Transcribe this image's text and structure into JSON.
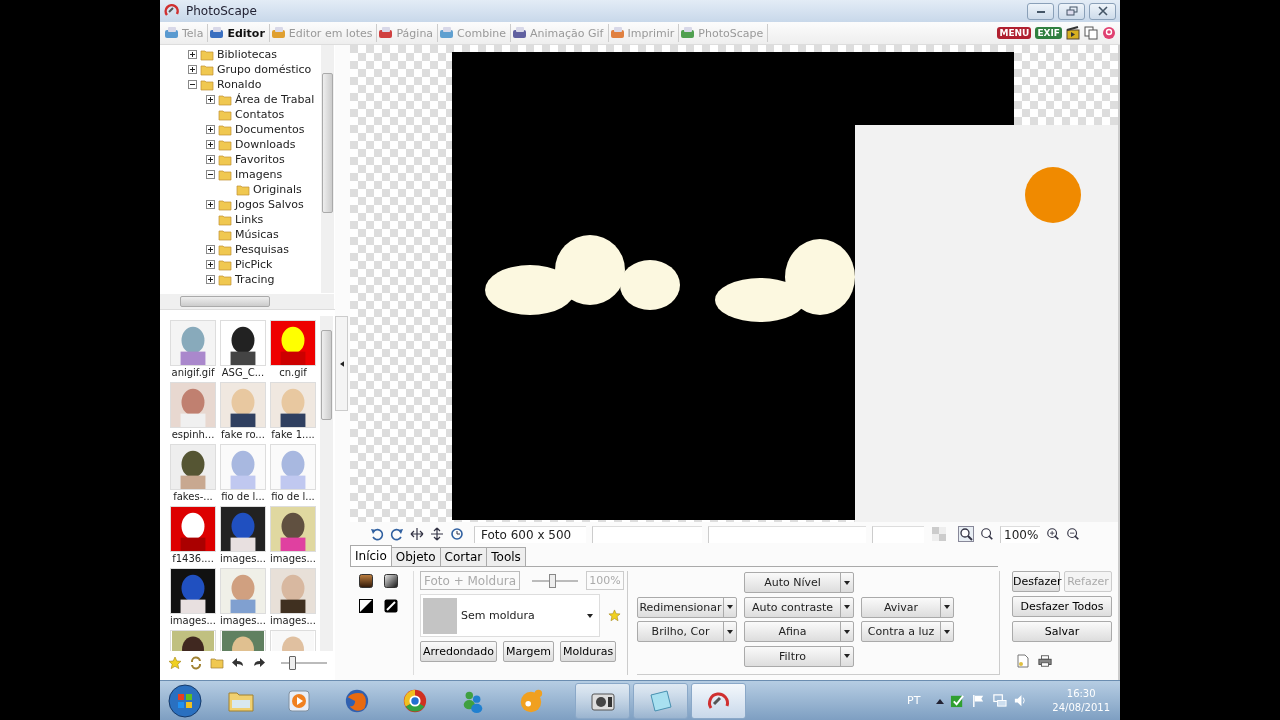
{
  "window": {
    "title": "PhotoScape"
  },
  "tabs": [
    {
      "label": "Tela",
      "selected": false
    },
    {
      "label": "Editor",
      "selected": true
    },
    {
      "label": "Editor em lotes",
      "selected": false
    },
    {
      "label": "Página",
      "selected": false
    },
    {
      "label": "Combine",
      "selected": false
    },
    {
      "label": "Animação Gif",
      "selected": false
    },
    {
      "label": "Imprimir",
      "selected": false
    },
    {
      "label": "PhotoScape",
      "selected": false
    }
  ],
  "toolbar": {
    "menu_label": "MENU",
    "exif_label": "EXIF"
  },
  "folder_tree": [
    {
      "label": "Bibliotecas",
      "expanded": false
    },
    {
      "label": "Grupo doméstico",
      "expanded": false
    },
    {
      "label": "Ronaldo",
      "expanded": true,
      "children": [
        {
          "label": "Área de Trabal",
          "expanded": false
        },
        {
          "label": "Contatos"
        },
        {
          "label": "Documentos",
          "expanded": false
        },
        {
          "label": "Downloads",
          "expanded": false
        },
        {
          "label": "Favoritos",
          "expanded": false
        },
        {
          "label": "Imagens",
          "expanded": true,
          "children": [
            {
              "label": "Originals"
            }
          ]
        },
        {
          "label": "Jogos Salvos",
          "expanded": false
        },
        {
          "label": "Links"
        },
        {
          "label": "Músicas"
        },
        {
          "label": "Pesquisas",
          "expanded": false
        },
        {
          "label": "PicPick",
          "expanded": false
        },
        {
          "label": "Tracing",
          "expanded": false
        }
      ]
    }
  ],
  "thumbnails": [
    {
      "kind": "captioned",
      "caption": "anigif.gif"
    },
    {
      "kind": "captioned",
      "caption": "ASG_C..."
    },
    {
      "kind": "captioned",
      "caption": "cn.gif"
    },
    {
      "kind": "captioned",
      "caption": "espinh..."
    },
    {
      "kind": "captioned",
      "caption": "fake ro..."
    },
    {
      "kind": "captioned",
      "caption": "fake 1...."
    },
    {
      "kind": "captioned",
      "caption": "fakes-..."
    },
    {
      "kind": "captioned",
      "caption": "fio de l..."
    },
    {
      "kind": "captioned",
      "caption": "fio de l..."
    },
    {
      "kind": "captioned",
      "caption": "f1436...."
    },
    {
      "kind": "captioned",
      "caption": "images..."
    },
    {
      "kind": "captioned",
      "caption": "images..."
    },
    {
      "kind": "captioned",
      "caption": "images..."
    },
    {
      "kind": "captioned",
      "caption": "images..."
    },
    {
      "kind": "captioned",
      "caption": "images..."
    },
    {
      "kind": "picture"
    },
    {
      "kind": "picture"
    },
    {
      "kind": "picture"
    }
  ],
  "thumbnail_size": {
    "level": 0.2
  },
  "status_bar": {
    "photo_size": "Foto 600 x 500",
    "zoom": "100%"
  },
  "edit_tabs": [
    {
      "label": "Início",
      "selected": true
    },
    {
      "label": "Objeto",
      "selected": false
    },
    {
      "label": "Cortar",
      "selected": false
    },
    {
      "label": "Tools",
      "selected": false
    }
  ],
  "frame": {
    "button": "Foto + Moldura",
    "button_disabled": true,
    "level": 0.4,
    "reading": "100%",
    "reading_disabled": true,
    "frame_name": "Sem moldura",
    "buttons": [
      "Arredondado",
      "Margem",
      "Molduras"
    ]
  },
  "filter_columns": [
    [
      "Redimensionar",
      "Brilho, Cor"
    ],
    [
      "Auto Nível",
      "Auto contraste",
      "Afina",
      "Filtro"
    ],
    [
      "Avivar",
      "Contra a luz"
    ]
  ],
  "history": [
    {
      "label": "Desfazer",
      "disabled": false
    },
    {
      "label": "Refazer",
      "disabled": true
    },
    {
      "label": "Desfazer Todos",
      "disabled": false
    },
    {
      "label": "Salvar",
      "disabled": false
    }
  ],
  "taskbar": {
    "language": "PT",
    "time": "16:30",
    "date": "24/08/2011"
  }
}
